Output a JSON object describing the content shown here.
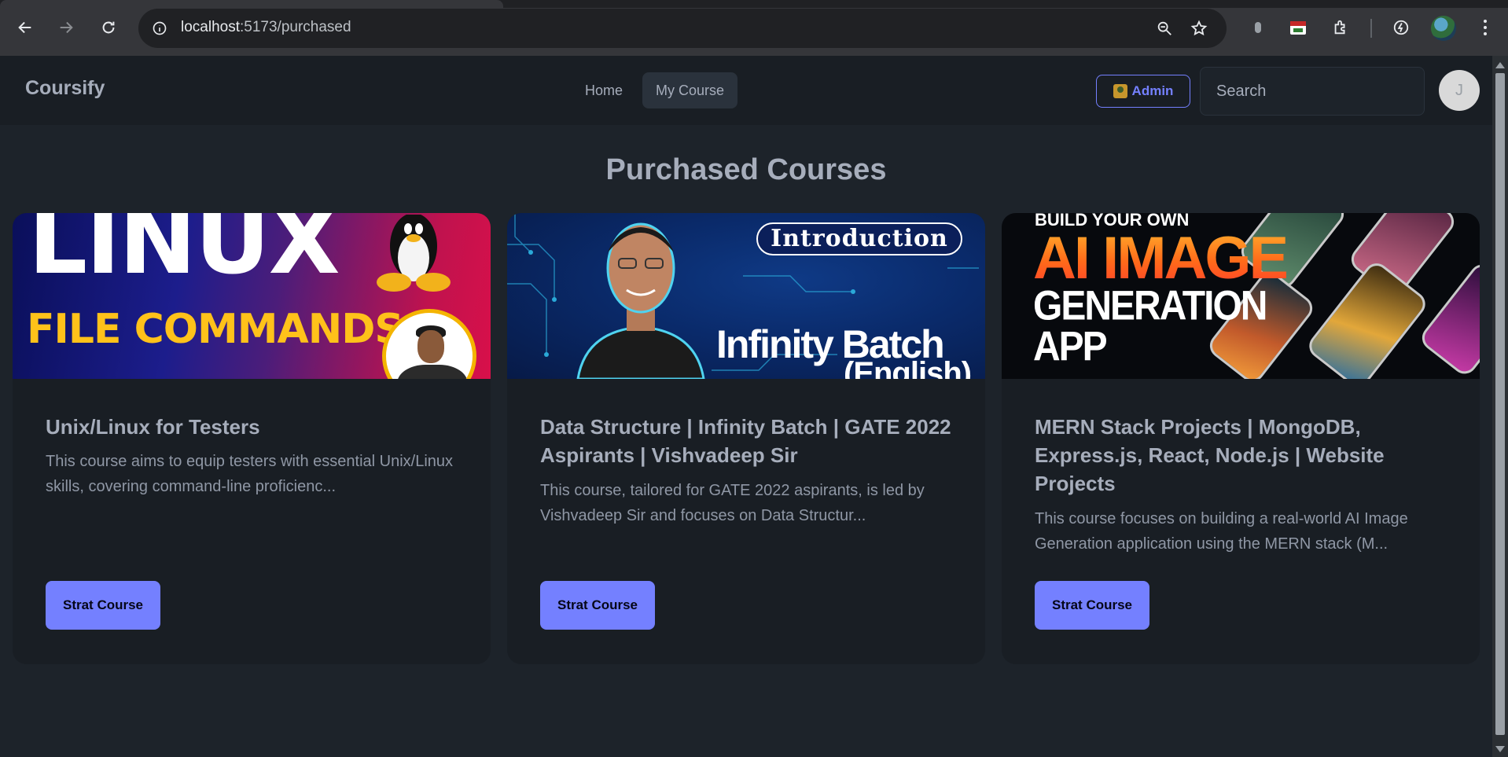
{
  "browser": {
    "url_host": "localhost",
    "url_rest": ":5173/purchased"
  },
  "navbar": {
    "brand": "Coursify",
    "menu": [
      {
        "label": "Home",
        "active": false
      },
      {
        "label": "My Course",
        "active": true
      }
    ],
    "admin_label": "Admin",
    "search_placeholder": "Search",
    "avatar_initial": "J"
  },
  "page": {
    "heading": "Purchased Courses"
  },
  "courses": [
    {
      "title": "Unix/Linux for Testers",
      "description": "This course aims to equip testers with essential Unix/Linux skills, covering command-line proficienc...",
      "button": "Strat Course",
      "thumb_text": [
        "LINUX",
        "FILE COMMANDS"
      ]
    },
    {
      "title": "Data Structure | Infinity Batch | GATE 2022 Aspirants | Vishvadeep Sir",
      "description": "This course, tailored for GATE 2022 aspirants, is led by Vishvadeep Sir and focuses on Data Structur...",
      "button": "Strat Course",
      "thumb_text": [
        "Introduction",
        "Infinity Batch",
        "(English)"
      ]
    },
    {
      "title": "MERN Stack Projects | MongoDB, Express.js, React, Node.js | Website Projects",
      "description": "This course focuses on building a real-world AI Image Generation application using the MERN stack (M...",
      "button": "Strat Course",
      "thumb_text": [
        "BUILD YOUR OWN",
        "AI IMAGE",
        "GENERATION",
        "APP"
      ]
    }
  ],
  "colors": {
    "accent": "#7480ff",
    "page_bg": "#1d232a",
    "card_bg": "#191e24",
    "text": "#a6adbb"
  }
}
